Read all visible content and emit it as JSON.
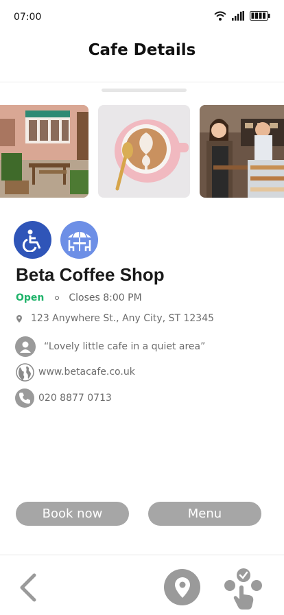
{
  "status_bar": {
    "time": "07:00",
    "icons": [
      "wifi-icon",
      "signal-icon",
      "battery-icon"
    ]
  },
  "header": {
    "title": "Cafe Details"
  },
  "gallery": {
    "photos": [
      "cafe-exterior-photo",
      "latte-art-photo",
      "baristas-counter-photo"
    ]
  },
  "amenities": [
    {
      "icon": "wheelchair-icon",
      "color": "#2f55b8"
    },
    {
      "icon": "outdoor-seating-icon",
      "color": "#6d8fe6"
    }
  ],
  "cafe": {
    "name": "Beta Coffee Shop",
    "open_status": "Open",
    "closing_time": "Closes 8:00 PM",
    "address": "123 Anywhere St., Any City, ST 12345",
    "description": "“Lovely little cafe in a quiet area”",
    "website": "www.betacafe.co.uk",
    "phone": "020 8877 0713"
  },
  "actions": {
    "book_label": "Book now",
    "menu_label": "Menu"
  },
  "bottom_nav": {
    "items": [
      "back-icon",
      "map-pin-icon",
      "tap-select-icon"
    ]
  },
  "colors": {
    "accent_green": "#1fb36a",
    "button_gray": "#a6a6a6",
    "icon_gray": "#9a9a9a"
  }
}
